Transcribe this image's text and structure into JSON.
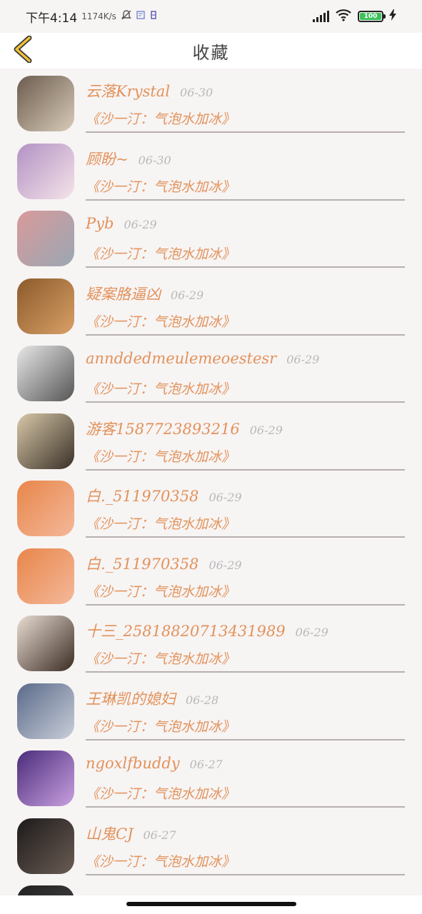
{
  "status_bar": {
    "time_text": "下午4:14",
    "speed_text": "1174K/s",
    "battery_level": "100",
    "colors": {
      "battery_fill": "#3cc15a"
    }
  },
  "nav": {
    "back_icon": "chevron-left-icon",
    "title": "收藏",
    "colors": {
      "back_icon": "#f3c236"
    }
  },
  "colors": {
    "accent": "#e2925a",
    "date": "#b8b8b8",
    "divider": "#b7b0ae"
  },
  "favorites": [
    {
      "name": "云落Krystal",
      "date": "06-30",
      "work": "《沙一汀：气泡水加冰》",
      "avatar_colors": [
        "#6b5c4e",
        "#d9cbb8"
      ]
    },
    {
      "name": "顾盼~",
      "date": "06-30",
      "work": "《沙一汀：气泡水加冰》",
      "avatar_colors": [
        "#b292c4",
        "#f5e3e8"
      ]
    },
    {
      "name": "Pyb",
      "date": "06-29",
      "work": "《沙一汀：气泡水加冰》",
      "avatar_colors": [
        "#d99a9a",
        "#9aa7b4"
      ]
    },
    {
      "name": "疑案胳逼凶",
      "date": "06-29",
      "work": "《沙一汀：气泡水加冰》",
      "avatar_colors": [
        "#8b5a2b",
        "#d9a066"
      ]
    },
    {
      "name": "annddedmeulemeoestesr",
      "date": "06-29",
      "work": "《沙一汀：气泡水加冰》",
      "avatar_colors": [
        "#e8e8e8",
        "#555555"
      ]
    },
    {
      "name": "游客1587723893216",
      "date": "06-29",
      "work": "《沙一汀：气泡水加冰》",
      "avatar_colors": [
        "#d8c8a8",
        "#3a3028"
      ]
    },
    {
      "name": "白._511970358",
      "date": "06-29",
      "work": "《沙一汀：气泡水加冰》",
      "avatar_colors": [
        "#e8864a",
        "#f4b89a"
      ]
    },
    {
      "name": "白._511970358",
      "date": "06-29",
      "work": "《沙一汀：气泡水加冰》",
      "avatar_colors": [
        "#e8864a",
        "#f4b89a"
      ]
    },
    {
      "name": "十三_25818820713431989",
      "date": "06-29",
      "work": "《沙一汀：气泡水加冰》",
      "avatar_colors": [
        "#e9ddd2",
        "#3b2c24"
      ]
    },
    {
      "name": "王琳凯的媳妇",
      "date": "06-28",
      "work": "《沙一汀：气泡水加冰》",
      "avatar_colors": [
        "#5a6a8a",
        "#c9ced8"
      ]
    },
    {
      "name": "ngoxlfbuddy",
      "date": "06-27",
      "work": "《沙一汀：气泡水加冰》",
      "avatar_colors": [
        "#4a2c7a",
        "#c9a0e0"
      ]
    },
    {
      "name": "山鬼CJ",
      "date": "06-27",
      "work": "《沙一汀：气泡水加冰》",
      "avatar_colors": [
        "#1d1a1a",
        "#6a5c54"
      ]
    },
    {
      "name": "",
      "date": "",
      "work": "",
      "avatar_colors": [
        "#222222",
        "#444444"
      ]
    }
  ]
}
